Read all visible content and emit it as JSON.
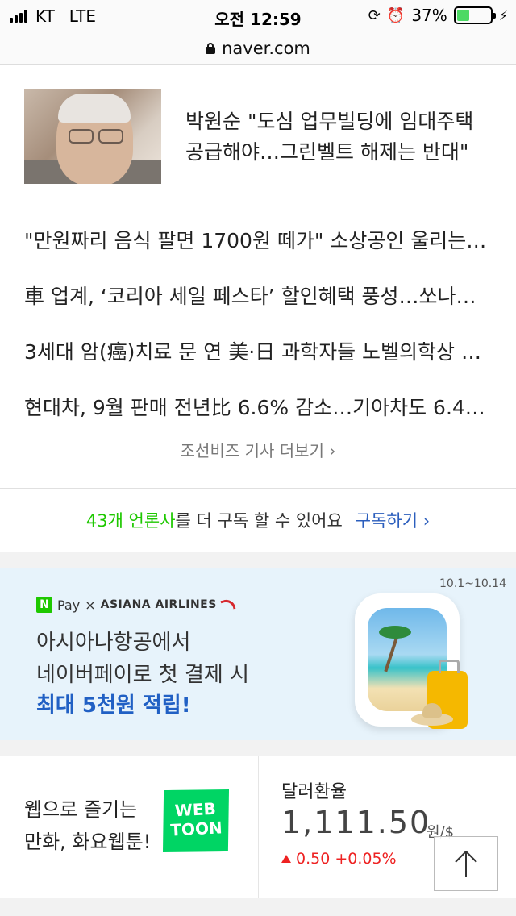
{
  "status_bar": {
    "carrier": "KT",
    "network": "LTE",
    "time": "오전 12:59",
    "battery": "37%",
    "battery_level": 0.37
  },
  "browser": {
    "url": "naver.com"
  },
  "news": {
    "featured_title_line1": "박원순 \"도심 업무빌딩에 임대주택",
    "featured_title_line2": "공급해야…그린벨트 해제는 반대\"",
    "items": [
      "\"만원짜리 음식 팔면 1700원 떼가\" 소상공인 울리는…",
      "車 업계, ‘코리아 세일 페스타’ 할인혜택 풍성…쏘나…",
      "3세대 암(癌)치료 문 연 美·日 과학자들 노벨의학상 …",
      "현대차, 9월 판매 전년比 6.6% 감소…기아차도 6.4…"
    ],
    "more_link": "조선비즈 기사 더보기 ›"
  },
  "subscribe": {
    "count_text": "43개 언론사",
    "rest_text": "를 더 구독 할 수 있어요",
    "link": "구독하기 ›"
  },
  "ad": {
    "brand_pay": "Pay",
    "brand_x": "×",
    "brand_airline": "ASIANA AIRLINES",
    "dates": "10.1~10.14",
    "line1": "아시아나항공에서",
    "line2": "네이버페이로 첫 결제 시",
    "line3": "최대 5천원 적립!"
  },
  "webtoon": {
    "line1": "웹으로 즐기는",
    "line2": "만화, 화요웹툰!",
    "logo_line1": "WEB",
    "logo_line2": "TOON"
  },
  "exchange": {
    "label": "달러환율",
    "rate": "1,111.50",
    "unit": "원/$",
    "change": "0.50",
    "change_pct": "+0.05%"
  },
  "colors": {
    "naver_green": "#1ec800",
    "link_blue": "#2b5ebd",
    "down_up_red": "#e22222"
  }
}
